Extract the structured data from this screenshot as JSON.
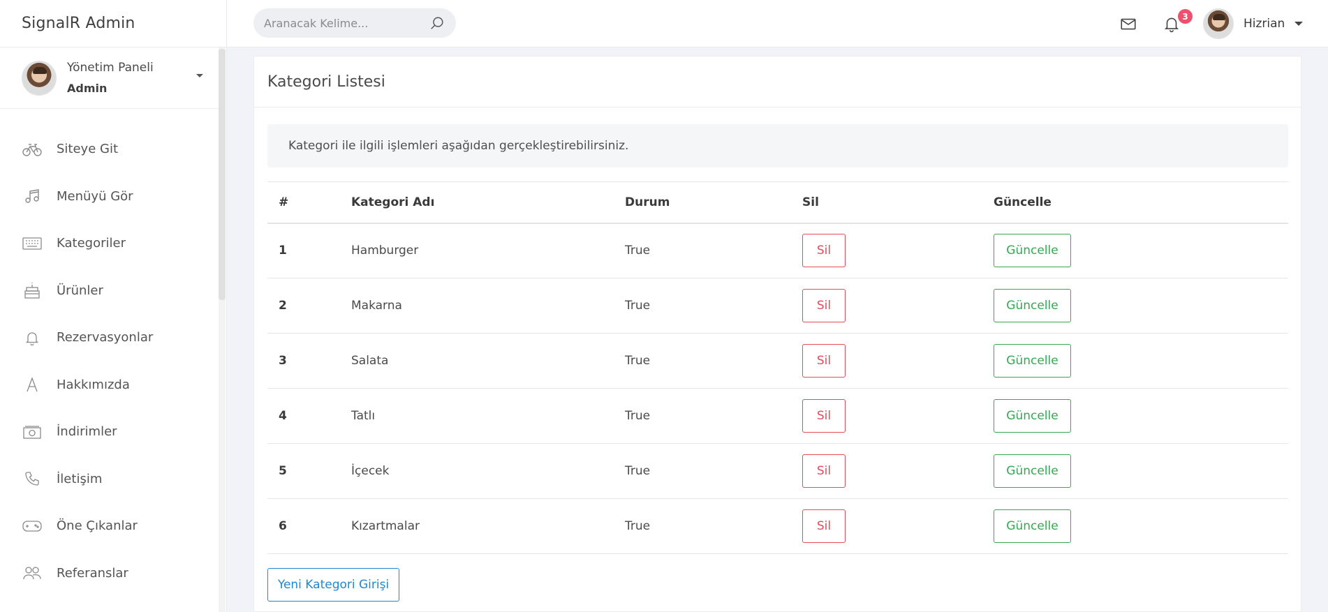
{
  "brand": "SignalR Admin",
  "search": {
    "placeholder": "Aranacak Kelime..."
  },
  "notifications": {
    "count": "3"
  },
  "user": {
    "name": "Hizrian"
  },
  "profile": {
    "title": "Yönetim Paneli",
    "role": "Admin"
  },
  "sidebar": {
    "items": [
      {
        "label": "Siteye Git",
        "icon": "bicycle-icon"
      },
      {
        "label": "Menüyü Gör",
        "icon": "music-note-icon"
      },
      {
        "label": "Kategoriler",
        "icon": "keyboard-icon"
      },
      {
        "label": "Ürünler",
        "icon": "cake-icon"
      },
      {
        "label": "Rezervasyonlar",
        "icon": "bell-icon"
      },
      {
        "label": "Hakkımızda",
        "icon": "letter-a-icon"
      },
      {
        "label": "İndirimler",
        "icon": "money-icon"
      },
      {
        "label": "İletişim",
        "icon": "phone-icon"
      },
      {
        "label": "Öne Çıkanlar",
        "icon": "gamepad-icon"
      },
      {
        "label": "Referanslar",
        "icon": "users-icon"
      }
    ]
  },
  "card": {
    "title": "Kategori Listesi",
    "info": "Kategori ile ilgili işlemleri aşağıdan gerçekleştirebilirsiniz.",
    "new_button": "Yeni Kategori Girişi"
  },
  "table": {
    "headers": [
      "#",
      "Kategori Adı",
      "Durum",
      "Sil",
      "Güncelle"
    ],
    "delete_label": "Sil",
    "update_label": "Güncelle",
    "rows": [
      {
        "id": "1",
        "name": "Hamburger",
        "status": "True"
      },
      {
        "id": "2",
        "name": "Makarna",
        "status": "True"
      },
      {
        "id": "3",
        "name": "Salata",
        "status": "True"
      },
      {
        "id": "4",
        "name": "Tatlı",
        "status": "True"
      },
      {
        "id": "5",
        "name": "İçecek",
        "status": "True"
      },
      {
        "id": "6",
        "name": "Kızartmalar",
        "status": "True"
      }
    ]
  },
  "colors": {
    "delete": "#e64a5b",
    "update": "#36a853",
    "primary": "#1e88d6",
    "badge": "#f0506e"
  }
}
